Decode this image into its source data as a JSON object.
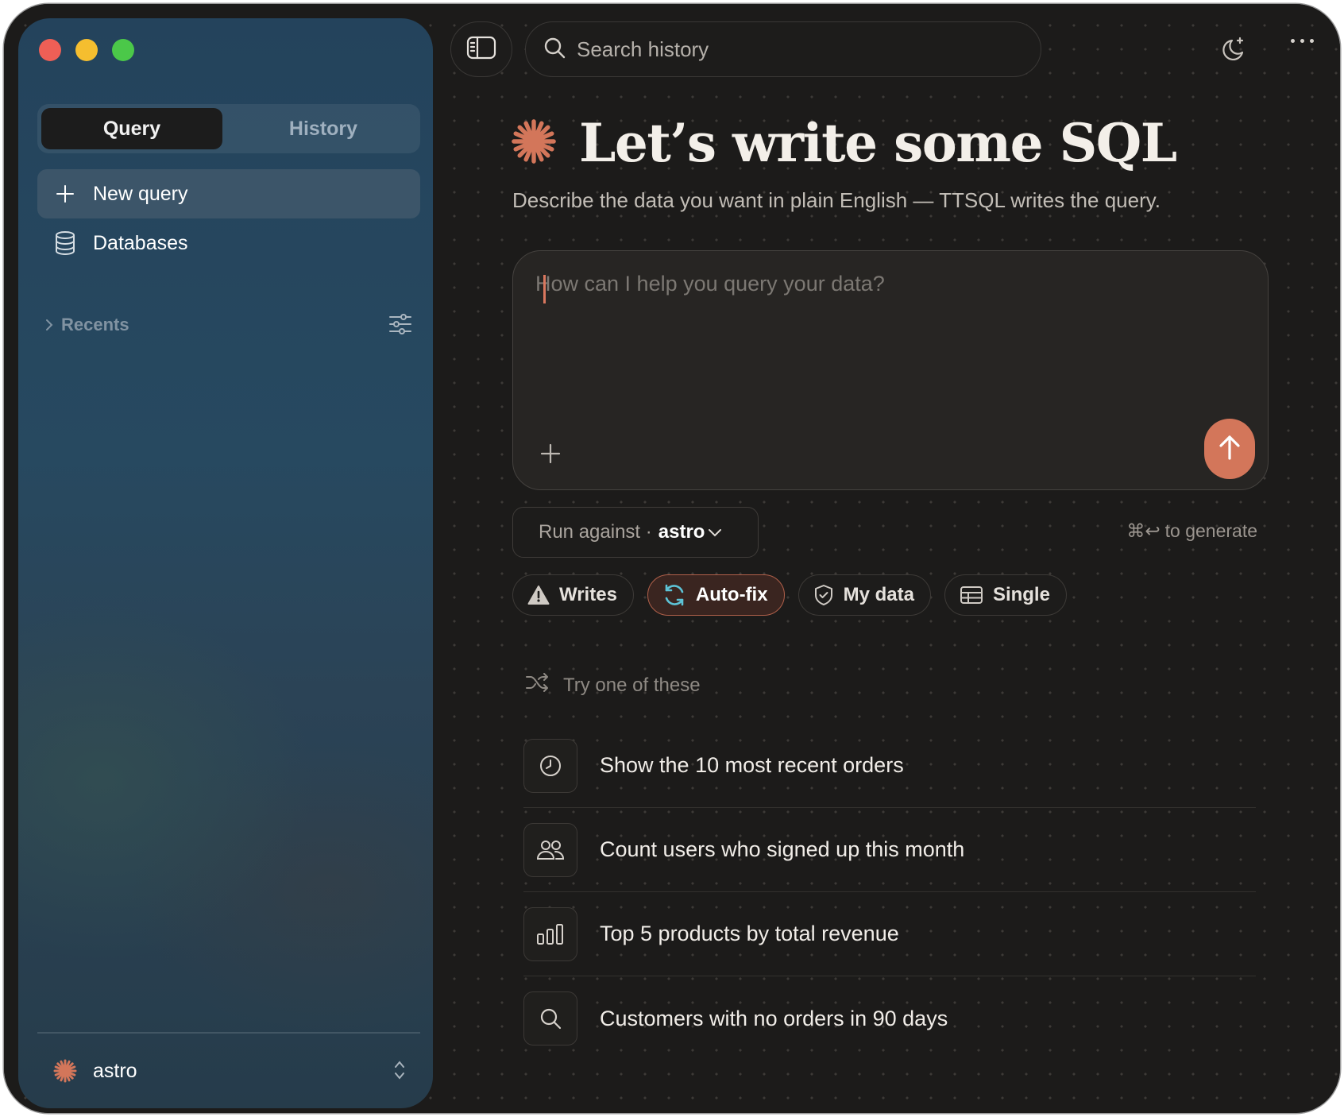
{
  "sidebar": {
    "tabs": [
      {
        "label": "Query",
        "active": true
      },
      {
        "label": "History",
        "active": false
      }
    ],
    "items": [
      {
        "label": "New query",
        "icon": "plus-icon",
        "active": true
      },
      {
        "label": "Databases",
        "icon": "database-icon",
        "active": false
      }
    ],
    "recents_label": "Recents",
    "workspace_name": "astro"
  },
  "toolbar": {
    "search_placeholder": "Search history"
  },
  "hero": {
    "title": "Let’s write some SQL",
    "subtitle": "Describe the data you want in plain English — TTSQL writes the query."
  },
  "prompt": {
    "placeholder": "How can I help you query your data?",
    "value": ""
  },
  "run_against": {
    "label": "Run against ·",
    "database": "astro"
  },
  "shortcut_hint": {
    "keys": "⌘↩",
    "text": "to generate"
  },
  "options": [
    {
      "label": "Writes",
      "icon": "warning-icon",
      "active": false
    },
    {
      "label": "Auto-fix",
      "icon": "refresh-icon",
      "active": true
    },
    {
      "label": "My data",
      "icon": "shield-check-icon",
      "active": false
    },
    {
      "label": "Single",
      "icon": "table-icon",
      "active": false
    }
  ],
  "suggestions": {
    "heading": "Try one of these",
    "items": [
      {
        "label": "Show the 10 most recent orders",
        "icon": "clock-icon"
      },
      {
        "label": "Count users who signed up this month",
        "icon": "users-icon"
      },
      {
        "label": "Top 5 products by total revenue",
        "icon": "bar-chart-icon"
      },
      {
        "label": "Customers with no orders in 90 days",
        "icon": "search-icon"
      }
    ]
  },
  "colors": {
    "accent": "#d3765a",
    "background": "#1c1b1a",
    "sidebar": "#274960"
  }
}
